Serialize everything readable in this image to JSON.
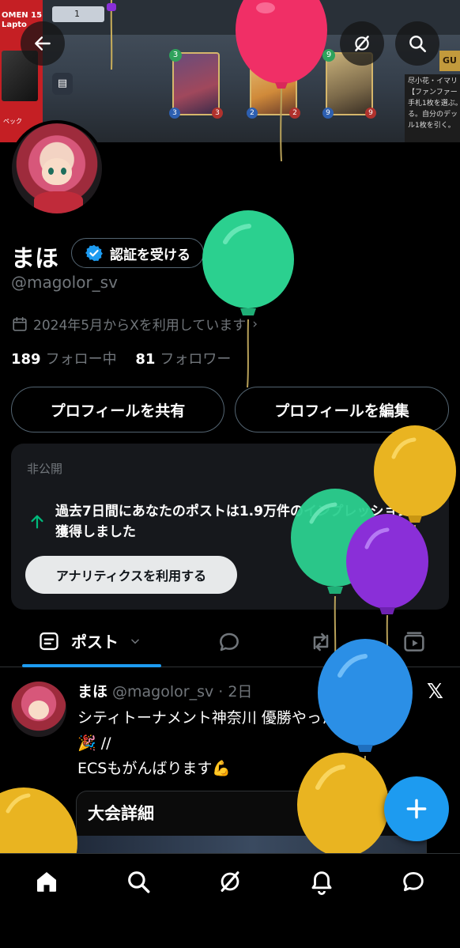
{
  "banner": {
    "ad_text": "OMEN 15\nLapto",
    "ad_sub": "ペック",
    "top_badge": "1",
    "tag": "GU",
    "card_text": "尽小花・イマリ\n【ファンファー\n手札1枚を選ぶ。\nる。自分のデッ\nル1枚を引く。",
    "cards": [
      {
        "cost": "3",
        "atk": "3",
        "hp": "3"
      },
      {
        "cost": "2",
        "atk": "2",
        "hp": "2"
      },
      {
        "cost": "9",
        "atk": "9",
        "hp": "9"
      }
    ]
  },
  "header_buttons": {
    "back_icon": "arrow-left-icon",
    "grok_icon": "grok-icon",
    "search_icon": "search-icon"
  },
  "profile": {
    "name": "まほ",
    "verify_label": "認証を受ける",
    "handle": "@magolor_sv",
    "joined": "2024年5月からXを利用しています",
    "following_count": "189",
    "following_label": "フォロー中",
    "followers_count": "81",
    "followers_label": "フォロワー",
    "share_button": "プロフィールを共有",
    "edit_button": "プロフィールを編集"
  },
  "private_card": {
    "title": "非公開",
    "message": "過去7日間にあなたのポストは1.9万件のインプレッションを獲得しました",
    "analytics_button": "アナリティクスを利用する",
    "close_icon": "close-icon"
  },
  "tabs": {
    "active_label": "ポスト",
    "icons": [
      "posts-icon",
      "replies-icon",
      "reposts-icon",
      "media-icon"
    ]
  },
  "tweet": {
    "name": "まほ",
    "meta": "@magolor_sv · 2日",
    "body_line1": "シティトーナメント神奈川 優勝やったー\\\\ 🎉🎉",
    "body_line2": "🎉 //",
    "body_line3": "ECSもがんばります💪",
    "card_title": "大会詳細",
    "x_logo": "𝕏"
  },
  "fab_icon": "plus-icon",
  "bottom_nav": [
    "home-icon",
    "search-icon",
    "grok-icon",
    "notifications-icon",
    "messages-icon"
  ],
  "colors": {
    "accent": "#1d9bf0",
    "muted": "#71767b",
    "balloon_green": "#2bd08f",
    "balloon_red": "#f02f66",
    "balloon_yellow": "#e9b421",
    "balloon_purple": "#8a2fd8",
    "balloon_blue": "#2b8fe6"
  }
}
